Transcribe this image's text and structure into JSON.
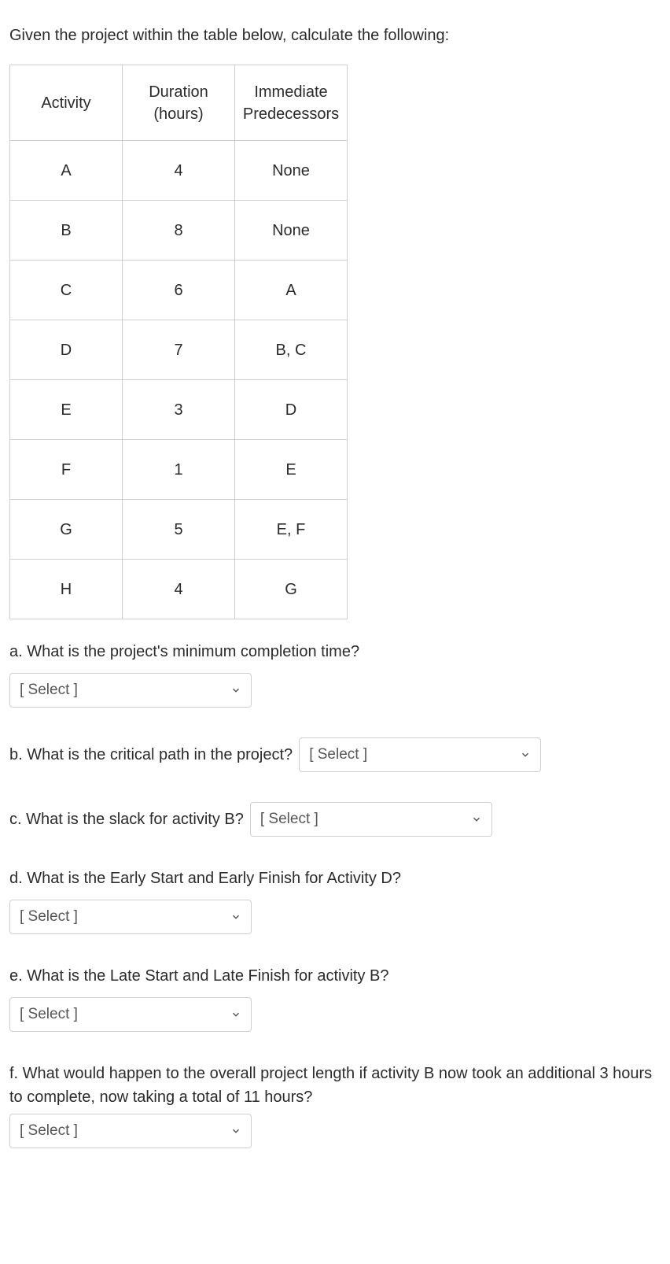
{
  "intro": "Given the project within the table below, calculate the following:",
  "table": {
    "headers": [
      "Activity",
      "Duration (hours)",
      "Immediate Predecessors"
    ],
    "rows": [
      {
        "activity": "A",
        "duration": "4",
        "pred": "None"
      },
      {
        "activity": "B",
        "duration": "8",
        "pred": "None"
      },
      {
        "activity": "C",
        "duration": "6",
        "pred": "A"
      },
      {
        "activity": "D",
        "duration": "7",
        "pred": "B, C"
      },
      {
        "activity": "E",
        "duration": "3",
        "pred": "D"
      },
      {
        "activity": "F",
        "duration": "1",
        "pred": "E"
      },
      {
        "activity": "G",
        "duration": "5",
        "pred": "E, F"
      },
      {
        "activity": "H",
        "duration": "4",
        "pred": "G"
      }
    ]
  },
  "questions": {
    "a": "a. What is the project's minimum completion time?",
    "b": "b. What is the critical path in the project?",
    "c": "c. What is the slack for activity B?",
    "d": "d. What is the Early Start and Early Finish for Activity D?",
    "e": "e. What is the Late Start and Late Finish for activity B?",
    "f": "f. What would happen to the overall project length if activity B now took an additional 3 hours to complete, now taking a total of 11 hours?"
  },
  "select_placeholder": "[ Select ]"
}
